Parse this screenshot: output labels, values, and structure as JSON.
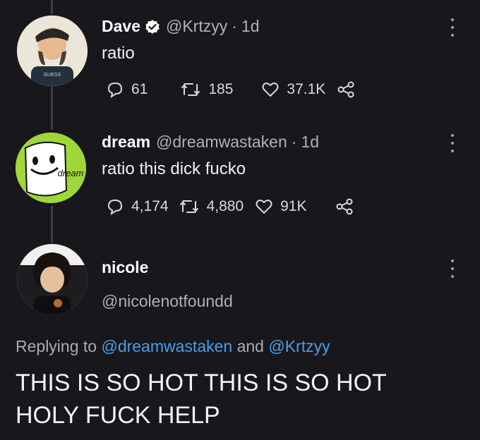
{
  "tweets": [
    {
      "display_name": "Dave",
      "verified": true,
      "handle": "@Krtzyy",
      "separator": "·",
      "time": "1d",
      "text": "ratio",
      "replies": "61",
      "retweets": "185",
      "likes": "37.1K",
      "avatar_text": "GUESS"
    },
    {
      "display_name": "dream",
      "handle": "@dreamwastaken",
      "separator": "·",
      "time": "1d",
      "text": "ratio this dick fucko",
      "replies": "4,174",
      "retweets": "4,880",
      "likes": "91K",
      "avatar_text": "dream"
    }
  ],
  "reply": {
    "display_name": "nicole",
    "handle": "@nicolenotfoundd",
    "replying_prefix": "Replying to",
    "replying_to_1": "@dreamwastaken",
    "replying_and": "and",
    "replying_to_2": "@Krtzyy",
    "text_line1": "THIS IS SO HOT THIS IS SO HOT",
    "text_line2": "HOLY FUCK HELP"
  },
  "icons": {
    "reply": "reply-icon",
    "retweet": "retweet-icon",
    "like": "heart-icon",
    "share": "share-icon",
    "more": "more-icon",
    "verified": "verified-badge-icon"
  },
  "colors": {
    "background": "#17171c",
    "link": "#4a9fe8",
    "dream_green": "#9fd639"
  }
}
